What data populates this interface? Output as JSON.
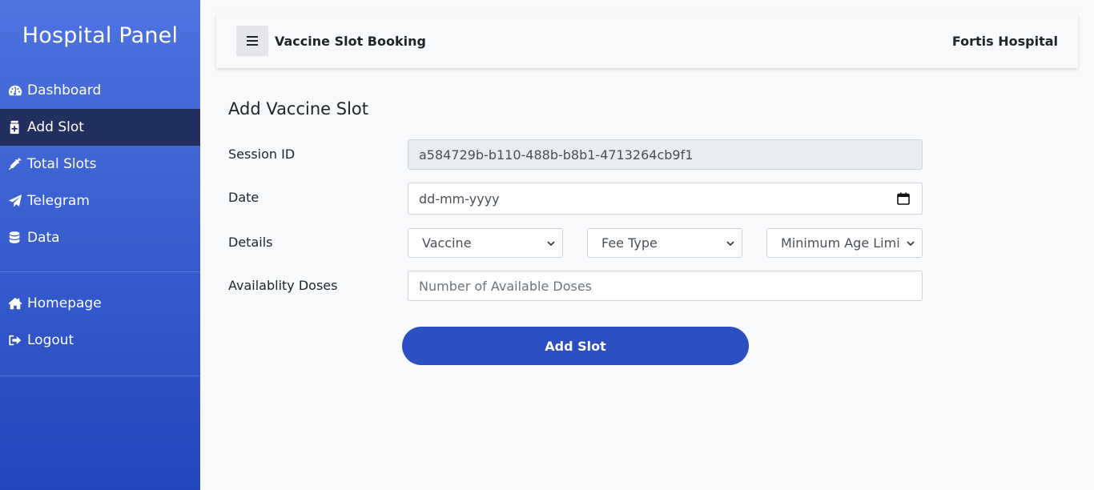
{
  "sidebar": {
    "brand": "Hospital Panel",
    "items": [
      {
        "label": "Dashboard",
        "icon": "tachometer-icon"
      },
      {
        "label": "Add Slot",
        "icon": "add-medical-icon"
      },
      {
        "label": "Total Slots",
        "icon": "syringe-icon"
      },
      {
        "label": "Telegram",
        "icon": "paper-plane-icon"
      },
      {
        "label": "Data",
        "icon": "database-icon"
      }
    ],
    "secondary": [
      {
        "label": "Homepage",
        "icon": "home-icon"
      },
      {
        "label": "Logout",
        "icon": "logout-icon"
      }
    ]
  },
  "topbar": {
    "title": "Vaccine Slot Booking",
    "hospital": "Fortis Hospital"
  },
  "form": {
    "heading": "Add Vaccine Slot",
    "session_label": "Session ID",
    "session_value": "a584729b-b110-488b-b8b1-4713264cb9f1",
    "date_label": "Date",
    "date_placeholder": "dd-mm-yyyy",
    "details_label": "Details",
    "vaccine_select": "Vaccine",
    "fee_select": "Fee Type",
    "age_select": "Minimum Age Limi",
    "doses_label": "Availablity Doses",
    "doses_placeholder": "Number of Available Doses",
    "submit_label": "Add Slot"
  },
  "colors": {
    "sidebar_top": "#4e73df",
    "sidebar_bottom": "#2247bd",
    "active_item": "#232f5e",
    "button": "#2c4fc2"
  }
}
